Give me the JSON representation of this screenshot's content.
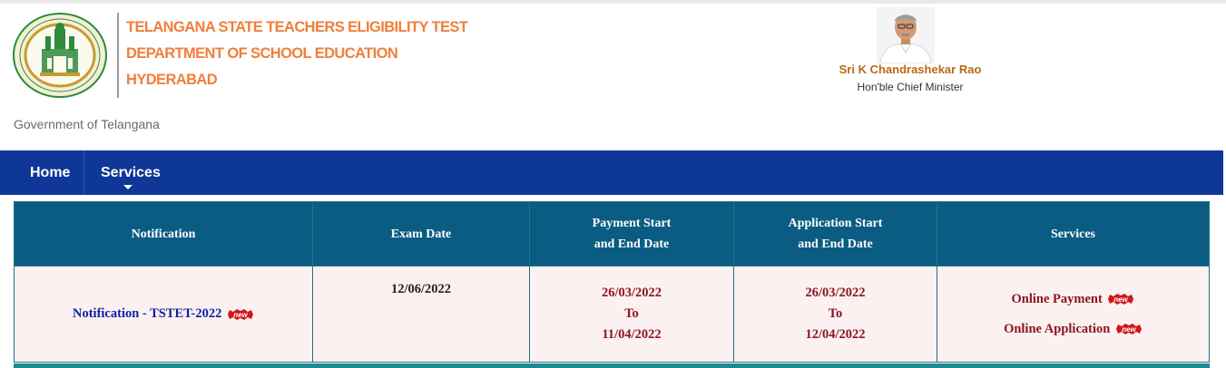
{
  "header": {
    "title_lines": [
      "TELANGANA STATE TEACHERS ELIGIBILITY TEST",
      "DEPARTMENT OF SCHOOL EDUCATION",
      "HYDERABAD"
    ],
    "government_label": "Government of Telangana",
    "emblem_text_top": "GOVERNMENT OF TELANGANA",
    "cm_name": "Sri K Chandrashekar Rao",
    "cm_title": "Hon'ble Chief Minister"
  },
  "nav": {
    "home_label": "Home",
    "services_label": "Services"
  },
  "table": {
    "headers": {
      "notification": "Notification",
      "exam_date": "Exam Date",
      "payment_line1": "Payment Start",
      "payment_line2": "and End Date",
      "application_line1": "Application Start",
      "application_line2": "and End Date",
      "services": "Services"
    },
    "row": {
      "notification_link": "Notification - TSTET-2022",
      "exam_date": "12/06/2022",
      "payment_start": "26/03/2022",
      "payment_to": "To",
      "payment_end": "11/04/2022",
      "application_start": "26/03/2022",
      "application_to": "To",
      "application_end": "12/04/2022",
      "online_payment": "Online Payment",
      "online_application": "Online Application"
    },
    "new_badge": "new"
  },
  "colors": {
    "title_orange": "#ef7f3b",
    "nav_blue": "#0f3797",
    "header_teal": "#0b5c82",
    "date_red": "#8b1522",
    "link_blue": "#0d22a3"
  }
}
